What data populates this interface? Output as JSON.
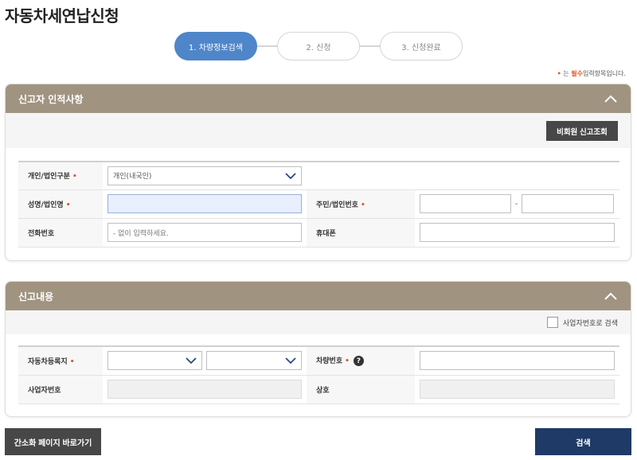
{
  "page": {
    "title": "자동차세연납신청"
  },
  "steps": [
    {
      "label": "1. 차량정보검색",
      "active": true
    },
    {
      "label": "2. 신청",
      "active": false
    },
    {
      "label": "3. 신청완료",
      "active": false
    }
  ],
  "required_note": {
    "mark": "•",
    "pre": "는",
    "emph": "필수",
    "post": "입력항목입니다."
  },
  "section_reporter": {
    "title": "신고자 인적사항",
    "lookup_button": "비회원 신고조회",
    "rows": {
      "type_label": "개인/법인구분",
      "type_value": "개인(내국인)",
      "name_label": "성명/법인명",
      "name_value": "",
      "id_label": "주민/법인번호",
      "id_sep": "-",
      "phone_label": "전화번호",
      "phone_placeholder": "- 없이 입력하세요.",
      "mobile_label": "휴대폰"
    },
    "required_mark": "•"
  },
  "section_report": {
    "title": "신고내용",
    "business_search_label": "사업자번호로 검색",
    "rows": {
      "region_label": "자동차등록지",
      "plate_label": "차량번호",
      "help_glyph": "?",
      "bizno_label": "사업자번호",
      "company_label": "상호"
    },
    "required_mark": "•"
  },
  "buttons": {
    "simple_page": "간소화 페이지 바로가기",
    "search": "검색"
  },
  "colors": {
    "step_active": "#4f86c9",
    "panel_header": "#a09481",
    "required": "#e8521f",
    "search_button": "#1f3a66",
    "simple_button": "#474747"
  }
}
